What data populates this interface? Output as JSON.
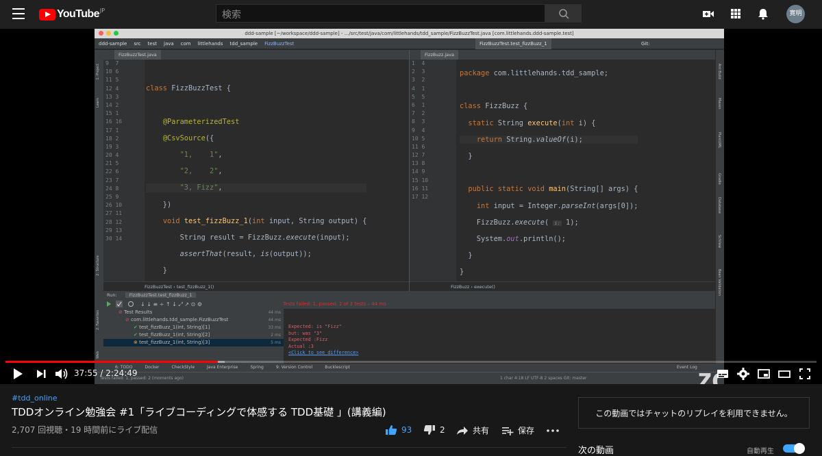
{
  "header": {
    "logo_text": "YouTube",
    "region": "JP",
    "search_placeholder": "検索",
    "avatar_text": "寛明"
  },
  "video": {
    "window_title": "ddd-sample [~/workspace/ddd-sample] - .../src/test/java/com/littlehands/tdd_sample/FizzBuzzTest.java [com.littlehands.ddd-sample.test]",
    "navbar": [
      "ddd-sample",
      "src",
      "test",
      "java",
      "com",
      "littlehands",
      "tdd_sample",
      "FizzBuzzTest"
    ],
    "run_config": "FizzBuzzTest.test_fizzBuzz_1",
    "git_label": "Git:",
    "left_tab": "FizzBuzzTest.java",
    "right_tab": "FizzBuzz.java",
    "left_gutter": [
      "9  7",
      "10 6",
      "11 5",
      "12 4",
      "13 3",
      "14 2",
      "15 1",
      "16 16",
      "17 1",
      "18 2",
      "19 3",
      "20 4",
      "21 5",
      "22 6",
      "23 7",
      "24 8",
      "25 9",
      "26 10",
      "27 11",
      "28 12",
      "29 13",
      "30 14"
    ],
    "right_gutter": [
      "1  4",
      "2  3",
      "3  2",
      "4  1",
      "5  5",
      "6  1",
      "7  2",
      "8  3",
      "9  4",
      "10 5",
      "11 6",
      "12 7",
      "13 8",
      "14 9",
      "15 10",
      "16 11",
      "17 12"
    ],
    "left_breadcrumb": [
      "FizzBuzzTest",
      "test_fizzBuzz_1()"
    ],
    "right_breadcrumb": [
      "FizzBuzz",
      "execute()"
    ],
    "run_label": "Run:",
    "run_tab": "FizzBuzzTest.test_fizzBuzz_1",
    "tests_status": "Tests failed: 1, passed: 2 of 3 tests – 44 ms",
    "tree": [
      {
        "label": "Test Results",
        "time": "44 ms"
      },
      {
        "label": "com.littlehands.tdd_sample.FizzBuzzTest",
        "time": "44 ms"
      },
      {
        "label": "test_fizzBuzz_1(int, String)[1]",
        "time": "33 ms"
      },
      {
        "label": "test_fizzBuzz_1(int, String)[2]",
        "time": "2 ms"
      },
      {
        "label": "test_fizzBuzz_1(int, String)[3]",
        "time": "5 ms"
      }
    ],
    "console": {
      "line1": "Expected: is \"Fizz\"",
      "line2": "     but: was \"3\"",
      "line3": "Expected :Fizz",
      "line4": "Actual   :3",
      "line5": "<Click to see difference>"
    },
    "bottom_tools": [
      "6: TODO",
      "Docker",
      "CheckStyle",
      "Java Enterprise",
      "Spring",
      "9: Version Control",
      "Bucklescript",
      "Event Log"
    ],
    "status_left": "Tests failed: 1, passed: 2 (moments ago)",
    "status_right": "1 char   4:18   LF   UTF-8   2 spaces   Git: master",
    "right_tools": [
      "Ant Build",
      "Maven",
      "PlantUML",
      "Gradle",
      "Database",
      "SciView",
      "Bean Validation"
    ],
    "left_tools": [
      "1: Project",
      "Learn",
      "2: Structure",
      "2: Favorites",
      "Web"
    ],
    "watermark": "zoom"
  },
  "player": {
    "time_current": "37:55",
    "time_total": "2:24:49",
    "progress_fraction": 0.262,
    "buffer_fraction": 0.27
  },
  "info": {
    "hashtag": "#tdd_online",
    "title": "TDDオンライン勉強会 #1「ライブコーディングで体感する TDD基礎 」(講義編)",
    "meta": "2,707 回視聴・19 時間前にライブ配信",
    "likes": "93",
    "dislikes": "2",
    "share": "共有",
    "save": "保存",
    "chat_notice": "この動画ではチャットのリプレイを利用できません。",
    "next_label": "次の動画",
    "autoplay_label": "自動再生"
  },
  "colors": {
    "accent": "#ff0000",
    "link": "#3ea6ff"
  }
}
